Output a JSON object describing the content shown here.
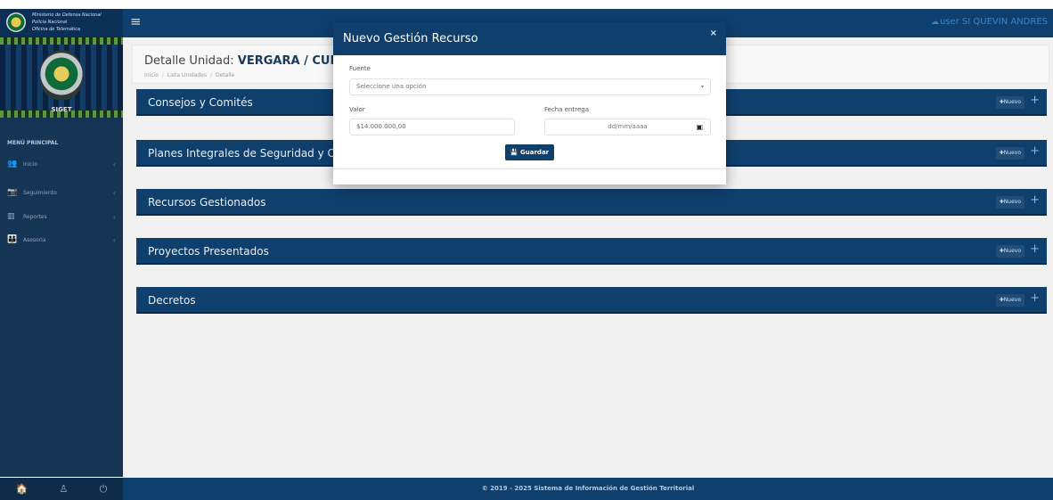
{
  "topbar": {
    "brand_lines": [
      "Ministerio de Defensa Nacional",
      "Policía Nacional",
      "Oficina de Telemática"
    ],
    "user_label": "user SI QUEVIN ANDRES"
  },
  "sidebar": {
    "header_text": "SIGET",
    "section_title": "MENÚ PRINCIPAL",
    "items": [
      {
        "label": "Inicio",
        "icon": "users-icon"
      },
      {
        "label": "Seguimiento",
        "icon": "camera-icon"
      },
      {
        "label": "Reportes",
        "icon": "bar-chart-icon"
      },
      {
        "label": "Asesoria",
        "icon": "group-icon"
      }
    ]
  },
  "page": {
    "title_prefix": "Detalle Unidad:",
    "title_unit": "VERGARA / CUNDIN",
    "breadcrumbs": [
      "Inicio",
      "Lista Unidades",
      "Detalle"
    ]
  },
  "panels": [
    {
      "title": "Consejos y Comités",
      "new_label": "Nuevo"
    },
    {
      "title": "Planes Integrales de Seguridad y Co",
      "new_label": "Nuevo"
    },
    {
      "title": "Recursos Gestionados",
      "new_label": "Nuevo"
    },
    {
      "title": "Proyectos Presentados",
      "new_label": "Nuevo"
    },
    {
      "title": "Decretos",
      "new_label": "Nuevo"
    }
  ],
  "modal": {
    "title": "Nuevo Gestión Recurso",
    "close": "×",
    "fuente_label": "Fuente",
    "fuente_placeholder": "Seleccione una opción",
    "valor_label": "Valor",
    "valor_value": "$14.000.000,00",
    "fecha_label": "Fecha entrega",
    "fecha_placeholder": "dd/mm/aaaa",
    "save_label": "Guardar"
  },
  "footer": {
    "text": "© 2019 - 2025 Sistema de Información de Gestión Territorial"
  },
  "colors": {
    "primary": "#0f3f6d",
    "sidebar": "#163555",
    "accent_user": "#3a86c6"
  }
}
